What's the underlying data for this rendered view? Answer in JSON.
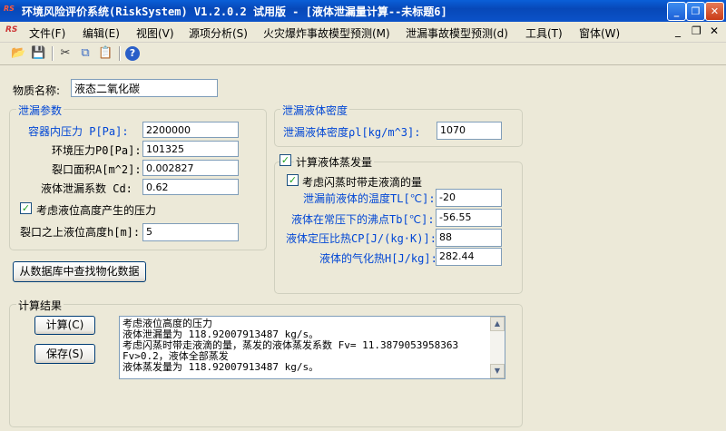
{
  "window": {
    "title": "环境风险评价系统(RiskSystem) V1.2.0.2 试用版 - [液体泄漏量计算--未标题6]",
    "app_icon": "RS"
  },
  "menu": [
    "文件(F)",
    "编辑(E)",
    "视图(V)",
    "源项分析(S)",
    "火灾爆炸事故模型预测(M)",
    "泄漏事故模型预测(d)",
    "工具(T)",
    "窗体(W)"
  ],
  "toolbar": [
    "open-folder-icon",
    "save-icon",
    "cut-icon",
    "copy-icon",
    "paste-icon",
    "help-icon"
  ],
  "substance": {
    "label": "物质名称:",
    "value": "液态二氧化碳"
  },
  "leak_params": {
    "title": "泄漏参数",
    "container_pressure": {
      "label": "容器内压力 P[Pa]:",
      "value": "2200000"
    },
    "ambient_pressure": {
      "label": "环境压力P0[Pa]:",
      "value": "101325"
    },
    "crack_area": {
      "label": "裂口面积A[m^2]:",
      "value": "0.002827"
    },
    "leak_coefficient": {
      "label": "液体泄漏系数  Cd:",
      "value": "0.62"
    },
    "consider_height": {
      "label": "考虑液位高度产生的压力",
      "checked": true
    },
    "liquid_height": {
      "label": "裂口之上液位高度h[m]:",
      "value": "5"
    }
  },
  "density_group": {
    "title": "泄漏液体密度",
    "density": {
      "label": "泄漏液体密度ρl[kg/m^3]:",
      "value": "1070"
    }
  },
  "evaporation": {
    "label": "计算液体蒸发量",
    "checked": true,
    "flash": {
      "label": "考虑闪蒸时带走液滴的量",
      "checked": true
    },
    "temp_before": {
      "label": "泄漏前液体的温度TL[℃]:",
      "value": "-20"
    },
    "boiling_point": {
      "label": "液体在常压下的沸点Tb[℃]:",
      "value": "-56.55"
    },
    "specific_heat": {
      "label": "液体定压比热CP[J/(kg·K)]:",
      "value": "88"
    },
    "vaporization_heat": {
      "label": "液体的气化热H[J/kg]:",
      "value": "282.44"
    }
  },
  "lookup_button": "从数据库中查找物化数据",
  "results": {
    "title": "计算结果",
    "calc_button": "计算(C)",
    "save_button": "保存(S)",
    "lines": [
      "考虑液位高度的压力",
      "液体泄漏量为 118.92007913487 kg/s。",
      "考虑闪蒸时带走液滴的量，蒸发的液体蒸发系数 Fv= 11.3879053958363",
      "Fv>0.2，液体全部蒸发",
      "液体蒸发量为 118.92007913487 kg/s。"
    ]
  },
  "colors": {
    "title_bar": "#0a5fd8",
    "group_title": "#0046d5",
    "window_bg": "#ece9d8"
  }
}
